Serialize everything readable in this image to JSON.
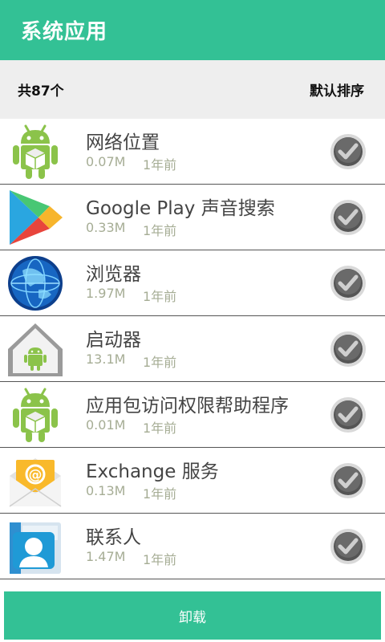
{
  "header": {
    "title": "系统应用"
  },
  "summary": {
    "count_label": "共87个",
    "sort_label": "默认排序"
  },
  "apps": [
    {
      "name": "网络位置",
      "size": "0.07M",
      "time": "1年前",
      "icon": "android-box-icon"
    },
    {
      "name": "Google Play 声音搜索",
      "size": "0.33M",
      "time": "1年前",
      "icon": "play-store-icon"
    },
    {
      "name": "浏览器",
      "size": "1.97M",
      "time": "1年前",
      "icon": "globe-icon"
    },
    {
      "name": "启动器",
      "size": "13.1M",
      "time": "1年前",
      "icon": "launcher-house-icon"
    },
    {
      "name": "应用包访问权限帮助程序",
      "size": "0.01M",
      "time": "1年前",
      "icon": "android-box-icon"
    },
    {
      "name": "Exchange 服务",
      "size": "0.13M",
      "time": "1年前",
      "icon": "email-envelope-icon"
    },
    {
      "name": "联系人",
      "size": "1.47M",
      "time": "1年前",
      "icon": "contacts-icon"
    }
  ],
  "footer": {
    "uninstall_label": "卸载"
  },
  "colors": {
    "accent": "#33c195",
    "subheader_bg": "#eeeeee",
    "meta_text": "#a6ad95"
  }
}
